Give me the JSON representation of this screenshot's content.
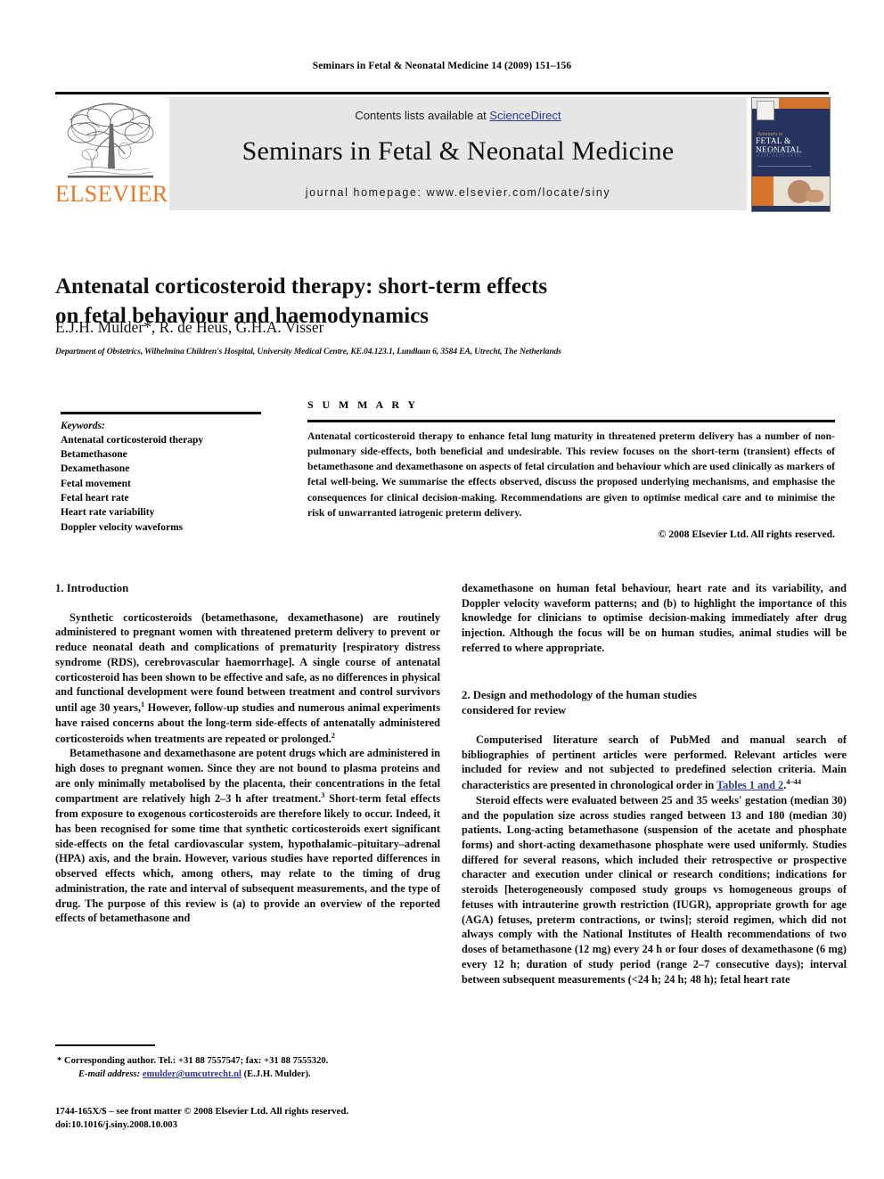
{
  "running_head": "Seminars in Fetal & Neonatal Medicine 14 (2009) 151–156",
  "masthead": {
    "contents_prefix": "Contents lists available at ",
    "sciencedirect": "ScienceDirect",
    "journal_title": "Seminars in Fetal & Neonatal Medicine",
    "homepage": "journal homepage: www.elsevier.com/locate/siny",
    "publisher_name": "ELSEVIER",
    "cover": {
      "line_small": "Seminars in",
      "line_main": "FETAL & NEONATAL",
      "line_script": "medicine"
    }
  },
  "article": {
    "title_line1": "Antenatal corticosteroid therapy: short-term effects",
    "title_line2": "on fetal behaviour and haemodynamics",
    "authors": "E.J.H. Mulder*, R. de Heus, G.H.A. Visser",
    "affiliation": "Department of Obstetrics, Wilhelmina Children's Hospital, University Medical Centre, KE.04.123.1, Lundlaan 6, 3584 EA, Utrecht, The Netherlands"
  },
  "keywords": {
    "heading": "Keywords:",
    "items": [
      "Antenatal corticosteroid therapy",
      "Betamethasone",
      "Dexamethasone",
      "Fetal movement",
      "Fetal heart rate",
      "Heart rate variability",
      "Doppler velocity waveforms"
    ]
  },
  "summary": {
    "heading": "S U M M A R Y",
    "text": "Antenatal corticosteroid therapy to enhance fetal lung maturity in threatened preterm delivery has a number of non-pulmonary side-effects, both beneficial and undesirable. This review focuses on the short-term (transient) effects of betamethasone and dexamethasone on aspects of fetal circulation and behaviour which are used clinically as markers of fetal well-being. We summarise the effects observed, discuss the proposed underlying mechanisms, and emphasise the consequences for clinical decision-making. Recommendations are given to optimise medical care and to minimise the risk of unwarranted iatrogenic preterm delivery.",
    "copyright": "© 2008 Elsevier Ltd. All rights reserved."
  },
  "sections": {
    "introduction_heading": "1. Introduction",
    "intro_p1_a": "Synthetic corticosteroids (betamethasone, dexamethasone) are routinely administered to pregnant women with threatened preterm delivery to prevent or reduce neonatal death and complications of prematurity [respiratory distress syndrome (RDS), cerebrovascular haemorrhage]. A single course of antenatal corticosteroid has been shown to be effective and safe, as no differences in physical and functional development were found between treatment and control survivors until age 30 years,",
    "intro_p1_ref1": "1",
    "intro_p1_b": " However, follow-up studies and numerous animal experiments have raised concerns about the long-term side-effects of antenatally administered corticosteroids when treatments are repeated or prolonged.",
    "intro_p1_ref2": "2",
    "intro_p2_a": "Betamethasone and dexamethasone are potent drugs which are administered in high doses to pregnant women. Since they are not bound to plasma proteins and are only minimally metabolised by the placenta, their concentrations in the fetal compartment are relatively high 2–3 h after treatment.",
    "intro_p2_ref3": "3",
    "intro_p2_b": " Short-term fetal effects from exposure to exogenous corticosteroids are therefore likely to occur. Indeed, it has been recognised for some time that synthetic corticosteroids exert significant side-effects on the fetal cardiovascular system, hypothalamic–pituitary–adrenal (HPA) axis, and the brain. However, various studies have reported differences in observed effects which, among others, may relate to the timing of drug administration, the rate and interval of subsequent measurements, and the type of drug. The purpose of this review is (a) to provide an overview of the reported effects of betamethasone and",
    "intro_p2_cont": "dexamethasone on human fetal behaviour, heart rate and its variability, and Doppler velocity waveform patterns; and (b) to highlight the importance of this knowledge for clinicians to optimise decision-making immediately after drug injection. Although the focus will be on human studies, animal studies will be referred to where appropriate.",
    "design_heading_l1": "2. Design and methodology of the human studies",
    "design_heading_l2": "considered for review",
    "design_p1_a": "Computerised literature search of PubMed and manual search of bibliographies of pertinent articles were performed. Relevant articles were included for review and not subjected to predefined selection criteria. Main characteristics are presented in chronological order in ",
    "design_p1_link": "Tables 1 and 2",
    "design_p1_b": ".",
    "design_p1_ref": "4–44",
    "design_p2": "Steroid effects were evaluated between 25 and 35 weeks' gestation (median 30) and the population size across studies ranged between 13 and 180 (median 30) patients. Long-acting betamethasone (suspension of the acetate and phosphate forms) and short-acting dexamethasone phosphate were used uniformly. Studies differed for several reasons, which included their retrospective or prospective character and execution under clinical or research conditions; indications for steroids [heterogeneously composed study groups vs homogeneous groups of fetuses with intrauterine growth restriction (IUGR), appropriate growth for age (AGA) fetuses, preterm contractions, or twins]; steroid regimen, which did not always comply with the National Institutes of Health recommendations of two doses of betamethasone (12 mg) every 24 h or four doses of dexamethasone (6 mg) every 12 h; duration of study period (range 2–7 consecutive days); interval between subsequent measurements (<24 h; 24 h; 48 h); fetal heart rate"
  },
  "footnotes": {
    "corresponding": "* Corresponding author. Tel.: +31 88 7557547; fax: +31 88 7555320.",
    "email_label": "E-mail address:",
    "email": "emulder@umcutrecht.nl",
    "email_owner": "(E.J.H. Mulder).",
    "issn_line": "1744-165X/$ – see front matter © 2008 Elsevier Ltd. All rights reserved.",
    "doi_line": "doi:10.1016/j.siny.2008.10.003"
  },
  "colors": {
    "elsevier_orange": "#E87722",
    "link_blue": "#2c3a96",
    "band_grey": "#e6e6e6",
    "cover_navy": "#26335c"
  }
}
